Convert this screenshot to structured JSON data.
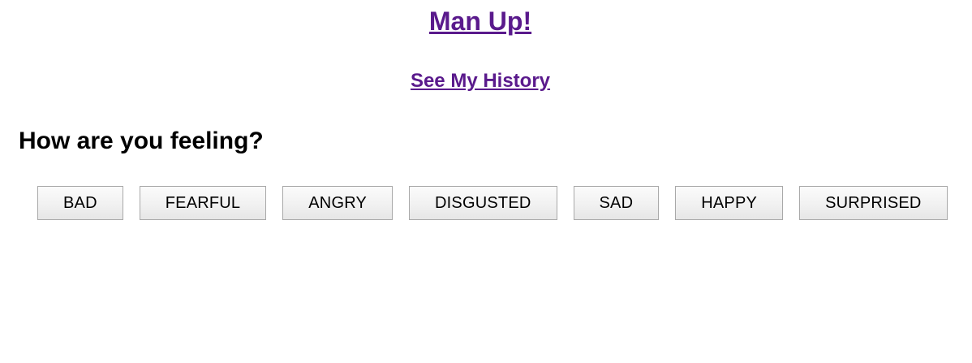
{
  "header": {
    "title": "Man Up!",
    "history_link": "See My History"
  },
  "main": {
    "question": "How are you feeling?",
    "feelings": [
      "BAD",
      "FEARFUL",
      "ANGRY",
      "DISGUSTED",
      "SAD",
      "HAPPY",
      "SURPRISED"
    ]
  },
  "colors": {
    "link": "#5a1a8c",
    "text": "#000000",
    "button_border": "#a9a9a9"
  }
}
